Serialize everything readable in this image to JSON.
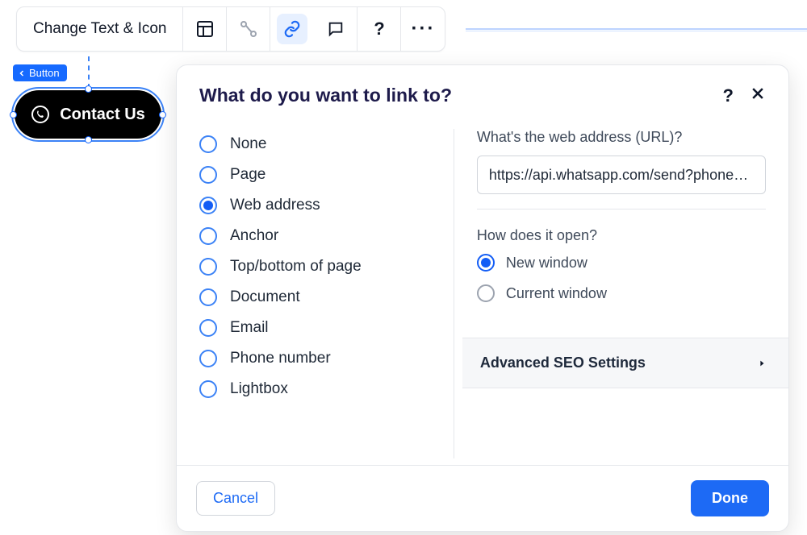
{
  "toolbar": {
    "change_text_label": "Change Text & Icon"
  },
  "badge": {
    "label": "Button"
  },
  "pill": {
    "text": "Contact Us"
  },
  "dialog": {
    "title": "What do you want to link to?",
    "link_types": [
      {
        "label": "None",
        "selected": false
      },
      {
        "label": "Page",
        "selected": false
      },
      {
        "label": "Web address",
        "selected": true
      },
      {
        "label": "Anchor",
        "selected": false
      },
      {
        "label": "Top/bottom of page",
        "selected": false
      },
      {
        "label": "Document",
        "selected": false
      },
      {
        "label": "Email",
        "selected": false
      },
      {
        "label": "Phone number",
        "selected": false
      },
      {
        "label": "Lightbox",
        "selected": false
      }
    ],
    "url_label": "What's the web address (URL)?",
    "url_value": "https://api.whatsapp.com/send?phone=<…",
    "open_label": "How does it open?",
    "open_options": [
      {
        "label": "New window",
        "selected": true
      },
      {
        "label": "Current window",
        "selected": false
      }
    ],
    "advanced_label": "Advanced SEO Settings",
    "cancel_label": "Cancel",
    "done_label": "Done"
  }
}
